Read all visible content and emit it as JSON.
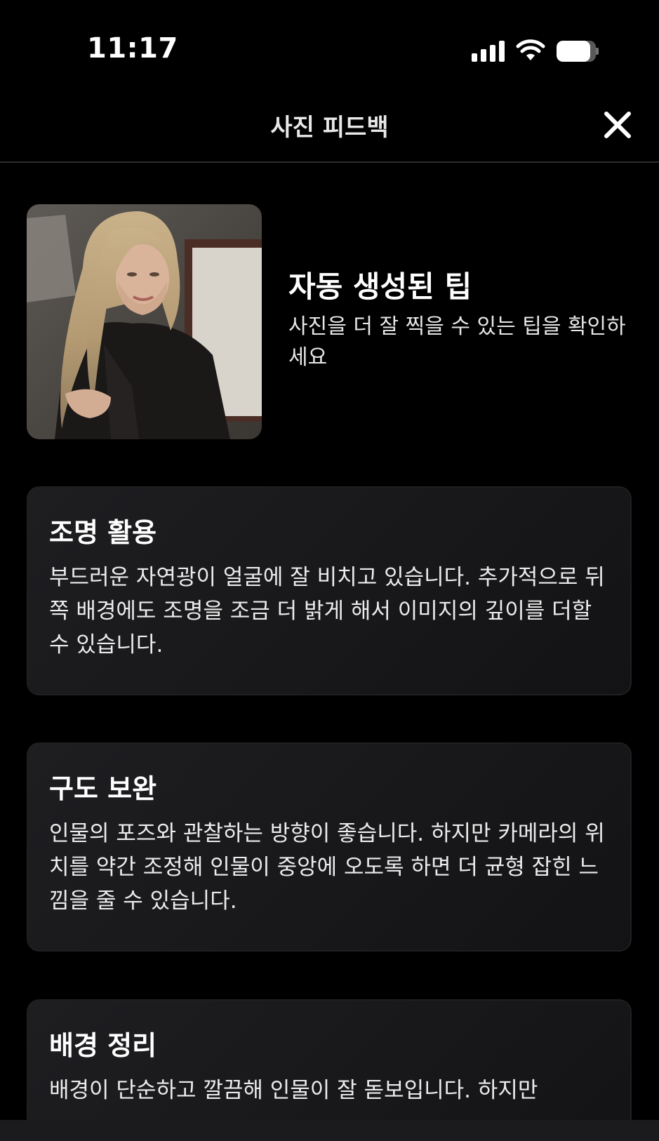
{
  "status_bar": {
    "time": "11:17",
    "signal_icon": "cellular-signal-icon",
    "wifi_icon": "wifi-icon",
    "battery_icon": "battery-icon",
    "battery_level": 0.85
  },
  "header": {
    "title": "사진 피드백",
    "close_icon": "close-icon"
  },
  "summary": {
    "photo_alt": "user-photo",
    "title": "자동 생성된 팁",
    "subtitle": "사진을 더 잘 찍을 수 있는 팁을 확인하세요"
  },
  "tips": [
    {
      "title": "조명 활용",
      "body": "부드러운 자연광이 얼굴에 잘 비치고 있습니다. 추가적으로 뒤쪽 배경에도 조명을 조금 더 밝게 해서 이미지의 깊이를 더할 수 있습니다."
    },
    {
      "title": "구도 보완",
      "body": "인물의 포즈와 관찰하는 방향이 좋습니다. 하지만 카메라의 위치를 약간 조정해 인물이 중앙에 오도록 하면 더 균형 잡힌 느낌을 줄 수 있습니다."
    },
    {
      "title": "배경 정리",
      "body": "배경이 단순하고 깔끔해 인물이 잘 돋보입니다. 하지만"
    }
  ],
  "colors": {
    "background": "#000000",
    "card": "#1a1a1c",
    "divider": "#2c2c2e"
  }
}
